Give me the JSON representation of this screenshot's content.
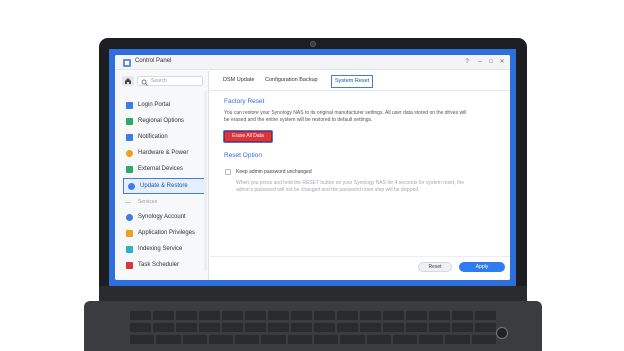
{
  "window": {
    "title": "Control Panel",
    "controls": {
      "help": "?",
      "minimize": "–",
      "maximize": "□",
      "close": "✕"
    }
  },
  "sidebar": {
    "search_placeholder": "Search",
    "items": [
      {
        "label": "Login Portal",
        "icon": "login-portal-icon",
        "color": "#3e7ce6"
      },
      {
        "label": "Regional Options",
        "icon": "regional-options-icon",
        "color": "#2fa86b"
      },
      {
        "label": "Notification",
        "icon": "notification-icon",
        "color": "#3e7ce6"
      },
      {
        "label": "Hardware & Power",
        "icon": "hardware-power-icon",
        "color": "#f0a020"
      },
      {
        "label": "External Devices",
        "icon": "external-devices-icon",
        "color": "#2fa86b"
      },
      {
        "label": "Update & Restore",
        "icon": "update-restore-icon",
        "color": "#3e7ce6",
        "active": true
      }
    ],
    "services_label": "Services",
    "service_items": [
      {
        "label": "Synology Account",
        "icon": "synology-account-icon",
        "color": "#3e7ce6"
      },
      {
        "label": "Application Privileges",
        "icon": "application-privileges-icon",
        "color": "#f0a020"
      },
      {
        "label": "Indexing Service",
        "icon": "indexing-service-icon",
        "color": "#2fb0c8"
      },
      {
        "label": "Task Scheduler",
        "icon": "task-scheduler-icon",
        "color": "#d9363e"
      }
    ]
  },
  "tabs": [
    "DSM Update",
    "Configuration Backup",
    "System Reset"
  ],
  "active_tab": "System Reset",
  "factory_reset": {
    "heading": "Factory Reset",
    "description_line1": "You can restore your Synology NAS to its original manufacturer settings. All user data stored on the drives will",
    "description_line2": "be erased and the entire system will be restored to default settings.",
    "erase_button": "Erase All Data"
  },
  "reset_option": {
    "heading": "Reset Option",
    "checkbox_label": "Keep admin password unchanged",
    "checkbox_checked": false,
    "note_line1": "When you press and hold the RESET button on your Synology NAS for 4 seconds for system reset, the",
    "note_line2": "admin's password will not be changed and the password reset step will be skipped."
  },
  "footer": {
    "reset_label": "Reset",
    "apply_label": "Apply"
  },
  "colors": {
    "accent": "#2f6fdc",
    "danger": "#d9363e",
    "apply": "#2f7cf0"
  }
}
